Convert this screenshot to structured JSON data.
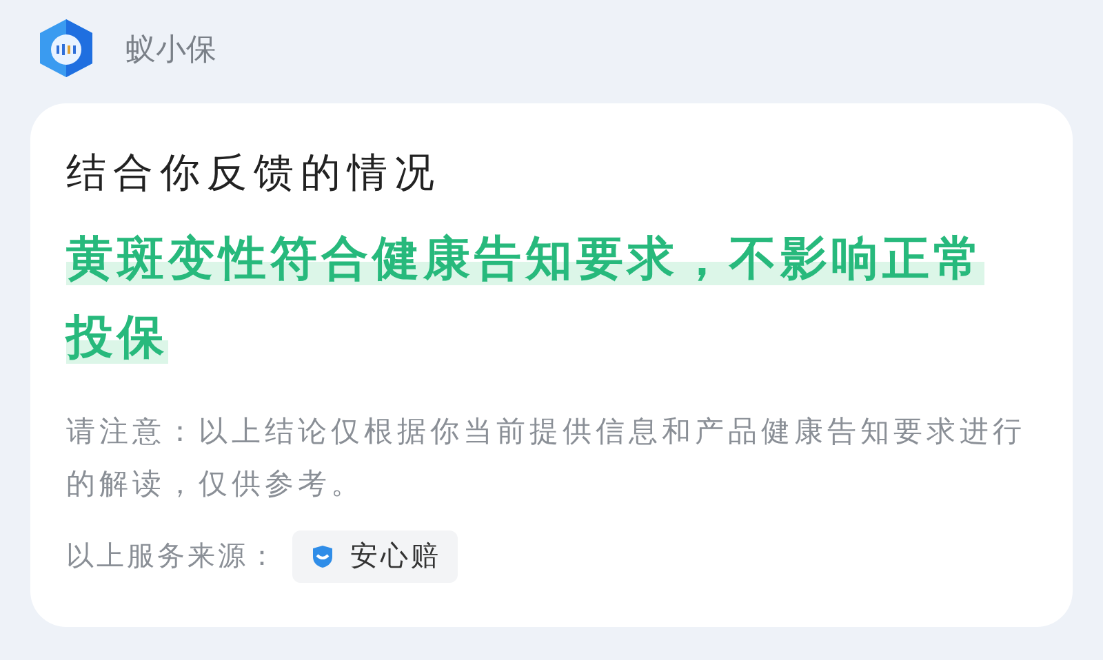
{
  "assistant": {
    "name": "蚁小保"
  },
  "card": {
    "title": "结合你反馈的情况",
    "conclusion": "黄斑变性符合健康告知要求，不影响正常投保",
    "note": "请注意：以上结论仅根据你当前提供信息和产品健康告知要求进行的解读，仅供参考。",
    "source_label": "以上服务来源：",
    "source": "安心赔"
  }
}
